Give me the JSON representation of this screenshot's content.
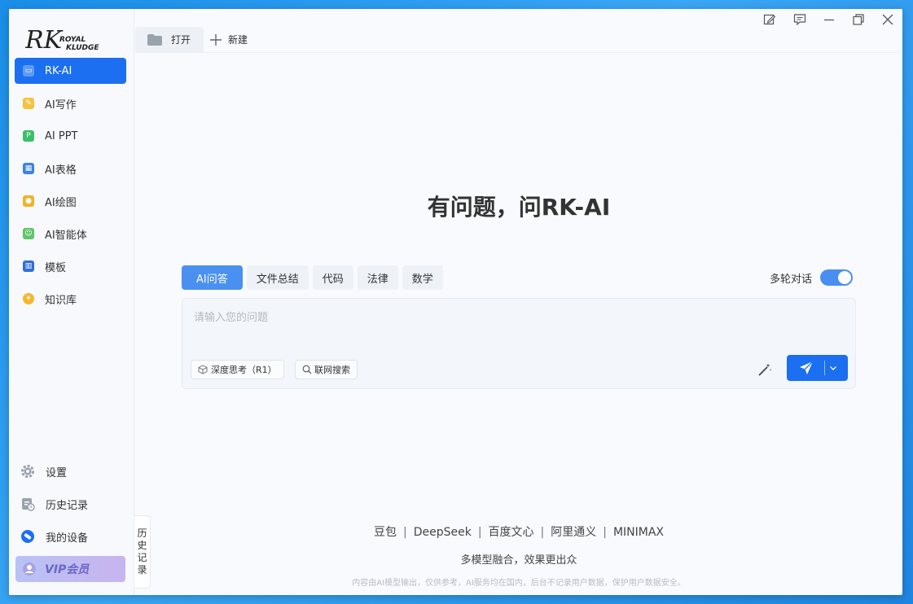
{
  "app": {
    "brand": "RK ROYAL KLUDGE"
  },
  "tabs": {
    "open": "打开",
    "new": "新建"
  },
  "sidebar": {
    "items": [
      {
        "label": "RK-AI",
        "icon": "chat-icon",
        "color": "#5e9bf7",
        "active": true
      },
      {
        "label": "AI写作",
        "icon": "write-icon",
        "color": "#f5c242"
      },
      {
        "label": "AI PPT",
        "icon": "ppt-icon",
        "color": "#3cbf6a"
      },
      {
        "label": "AI表格",
        "icon": "sheet-icon",
        "color": "#3b82e6"
      },
      {
        "label": "AI绘图",
        "icon": "palette-icon",
        "color": "#f0b429"
      },
      {
        "label": "AI智能体",
        "icon": "robot-icon",
        "color": "#5fc46a"
      },
      {
        "label": "模板",
        "icon": "template-icon",
        "color": "#2f6fd8"
      },
      {
        "label": "知识库",
        "icon": "bulb-icon",
        "color": "#f5b82e"
      }
    ],
    "bottom": [
      {
        "label": "设置",
        "icon": "gear-icon"
      },
      {
        "label": "历史记录",
        "icon": "history-icon"
      },
      {
        "label": "我的设备",
        "icon": "device-icon"
      }
    ],
    "vip": "VIP会员",
    "history_tab": [
      "历",
      "史",
      "记",
      "录"
    ]
  },
  "main": {
    "headline": "有问题，问RK-AI",
    "qtabs": [
      "AI问答",
      "文件总结",
      "代码",
      "法律",
      "数学"
    ],
    "multi_turn": {
      "label": "多轮对话",
      "on": true
    },
    "input_placeholder": "请输入您的问题",
    "chips": {
      "deep_think": "深度思考（R1）",
      "web_search": "联网搜索"
    },
    "models": [
      "豆包",
      "DeepSeek",
      "百度文心",
      "阿里通义",
      "MINIMAX"
    ],
    "motto": "多模型融合，效果更出众",
    "disclaimer": "内容由AI模型输出，仅供参考，AI服务均在国内，后台不记录用户数据，保护用户数据安全。"
  },
  "colors": {
    "accent": "#1b6ff0",
    "qtab_active": "#4a90f0",
    "vip": "#6b66c9"
  }
}
